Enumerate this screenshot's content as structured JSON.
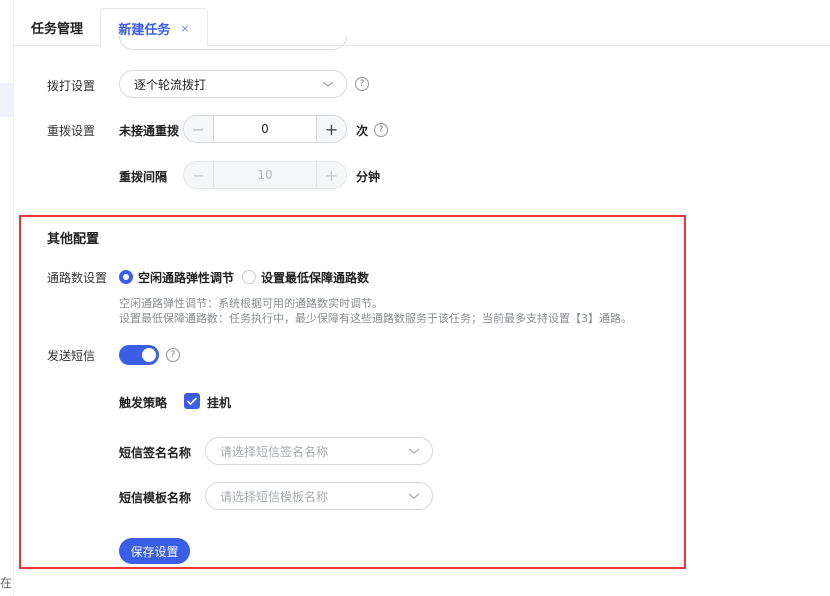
{
  "tabs": {
    "task_mgmt": "任务管理",
    "new_task": "新建任务",
    "close": "×"
  },
  "left_char": "在",
  "dial": {
    "label": "拨打设置",
    "mode_value": "逐个轮流拨打",
    "help": "?"
  },
  "redial": {
    "label": "重拨设置",
    "no_answer_label": "未接通重拨",
    "no_answer_value": "0",
    "no_answer_unit": "次",
    "interval_label": "重拨间隔",
    "interval_value": "10",
    "interval_unit": "分钟",
    "minus": "−",
    "plus": "+"
  },
  "other": {
    "title": "其他配置",
    "channels": {
      "label": "通路数设置",
      "option_elastic": "空闲通路弹性调节",
      "option_min": "设置最低保障通路数",
      "desc_line1": "空闲通路弹性调节：系统根据可用的通路数实时调节。",
      "desc_line2": "设置最低保障通路数：任务执行中，最少保障有这些通路数服务于该任务；当前最多支持设置【3】通路。"
    },
    "sms": {
      "label": "发送短信",
      "enabled": true,
      "trigger_label": "触发策略",
      "trigger_option": "挂机",
      "sign_label": "短信签名名称",
      "sign_placeholder": "请选择短信签名名称",
      "template_label": "短信模板名称",
      "template_placeholder": "请选择短信模板名称"
    },
    "save_button": "保存设置"
  },
  "colors": {
    "accent": "#3a5ee8",
    "highlight_border": "#e53935"
  }
}
